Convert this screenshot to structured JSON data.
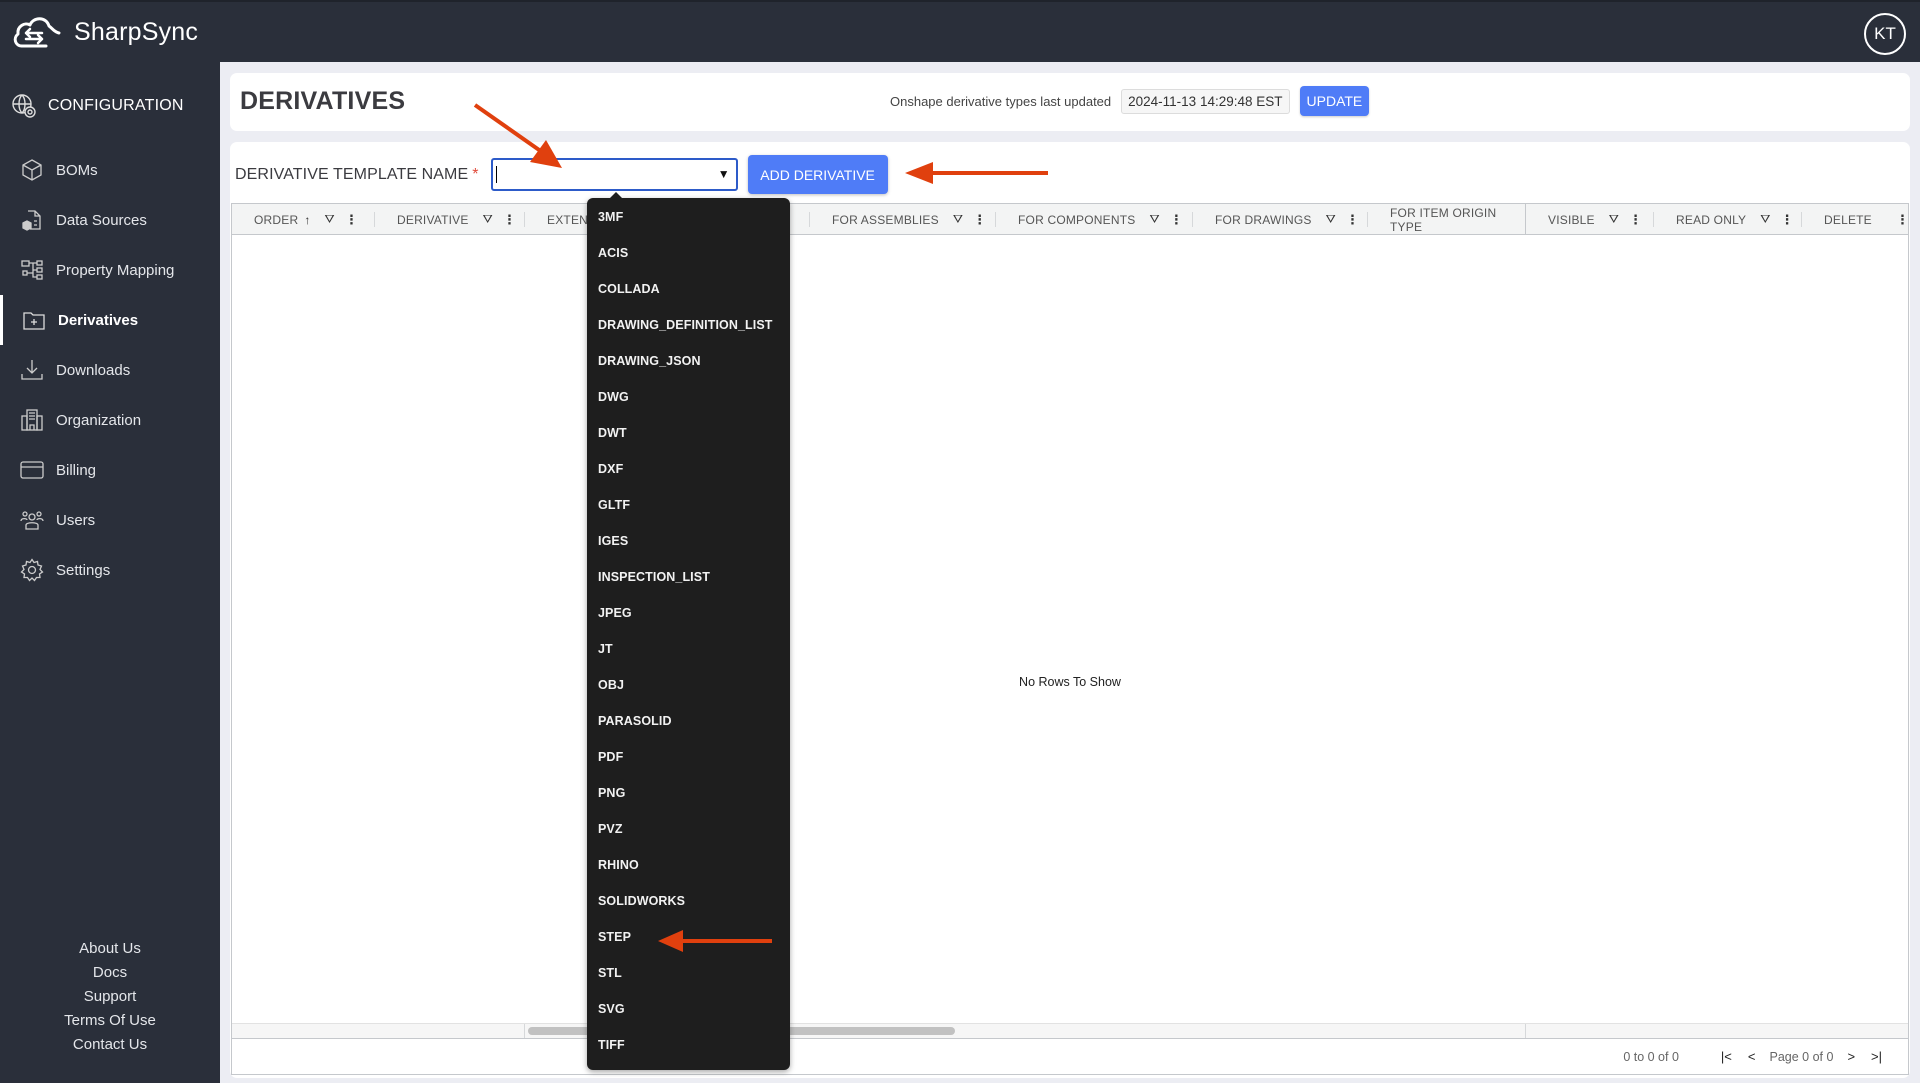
{
  "app": {
    "name": "SharpSync",
    "user_initials": "KT"
  },
  "sidebar": {
    "section_label": "CONFIGURATION",
    "items": [
      {
        "label": "BOMs",
        "icon": "cube-icon",
        "active": false
      },
      {
        "label": "Data Sources",
        "icon": "data-sources-icon",
        "active": false
      },
      {
        "label": "Property Mapping",
        "icon": "property-mapping-icon",
        "active": false
      },
      {
        "label": "Derivatives",
        "icon": "folder-plus-icon",
        "active": true
      },
      {
        "label": "Downloads",
        "icon": "download-icon",
        "active": false
      },
      {
        "label": "Organization",
        "icon": "building-icon",
        "active": false
      },
      {
        "label": "Billing",
        "icon": "credit-card-icon",
        "active": false
      },
      {
        "label": "Users",
        "icon": "users-icon",
        "active": false
      },
      {
        "label": "Settings",
        "icon": "gear-icon",
        "active": false
      }
    ],
    "footer_links": [
      "About Us",
      "Docs",
      "Support",
      "Terms Of Use",
      "Contact Us"
    ]
  },
  "header": {
    "title": "DERIVATIVES",
    "updated_label": "Onshape derivative types last updated",
    "updated_value": "2024-11-13 14:29:48 EST",
    "update_button": "UPDATE"
  },
  "form": {
    "template_label": "DERIVATIVE TEMPLATE NAME",
    "required_marker": "*",
    "template_value": "",
    "add_button": "ADD DERIVATIVE"
  },
  "grid": {
    "columns": [
      {
        "label": "ORDER",
        "sort": "↑",
        "filter": true,
        "menu": true
      },
      {
        "label": "DERIVATIVE",
        "filter": true,
        "menu": true
      },
      {
        "label": "EXTENSION",
        "filter": true,
        "menu": true
      },
      {
        "label": "",
        "filter": false,
        "menu": false
      },
      {
        "label": "FOR ASSEMBLIES",
        "filter": true,
        "menu": true
      },
      {
        "label": "FOR COMPONENTS",
        "filter": true,
        "menu": true
      },
      {
        "label": "FOR DRAWINGS",
        "filter": true,
        "menu": true
      },
      {
        "label": "FOR ITEM ORIGIN TYPE",
        "filter": false,
        "menu": false
      },
      {
        "label": "VISIBLE",
        "filter": true,
        "menu": true
      },
      {
        "label": "READ ONLY",
        "filter": true,
        "menu": true
      },
      {
        "label": "DELETE",
        "filter": false,
        "menu": true
      }
    ],
    "empty_message": "No Rows To Show",
    "pager": {
      "summary": "0 to 0 of 0",
      "page_label": "Page 0 of 0"
    }
  },
  "dropdown": {
    "options": [
      "3MF",
      "ACIS",
      "COLLADA",
      "DRAWING_DEFINITION_LIST",
      "DRAWING_JSON",
      "DWG",
      "DWT",
      "DXF",
      "GLTF",
      "IGES",
      "INSPECTION_LIST",
      "JPEG",
      "JT",
      "OBJ",
      "PARASOLID",
      "PDF",
      "PNG",
      "PVZ",
      "RHINO",
      "SOLIDWORKS",
      "STEP",
      "STL",
      "SVG",
      "TIFF"
    ],
    "highlighted_by_arrow": "STEP"
  },
  "colors": {
    "topbar": "#2a2f3a",
    "accent": "#4f7cf7",
    "annotation_arrow": "#e0400e",
    "dropdown_bg": "#1e1e1e"
  }
}
